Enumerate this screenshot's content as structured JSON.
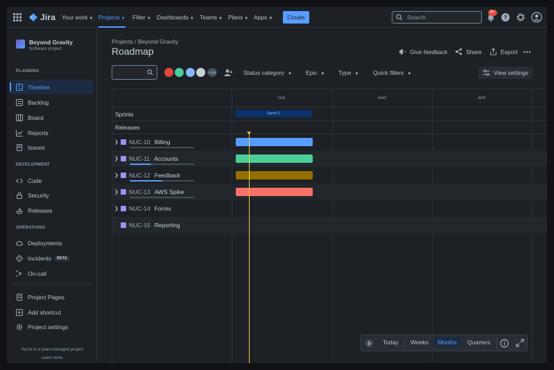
{
  "topnav": {
    "logo": "Jira",
    "items": [
      {
        "label": "Your work"
      },
      {
        "label": "Projects"
      },
      {
        "label": "Filter"
      },
      {
        "label": "Dashboards"
      },
      {
        "label": "Teams"
      },
      {
        "label": "Plans"
      },
      {
        "label": "Apps"
      }
    ],
    "create_label": "Create",
    "search_placeholder": "Search",
    "notification_badge": "9+"
  },
  "sidebar": {
    "project_name": "Beyond Gravity",
    "project_type": "Software project",
    "sections": [
      {
        "heading": "PLANNING",
        "items": [
          "Timeline",
          "Backlog",
          "Board",
          "Reports",
          "Issues"
        ]
      },
      {
        "heading": "DEVELOPMENT",
        "items": [
          "Code",
          "Security",
          "Releases"
        ]
      },
      {
        "heading": "OPERATIONS",
        "items": [
          "Deployments",
          "Incidents",
          "On-call"
        ]
      }
    ],
    "incidents_badge": "BETA",
    "footer_items": [
      "Project Pages",
      "Add shortcut",
      "Project settings"
    ],
    "team_note": "You're in a team-managed project",
    "learn_more": "Learn more"
  },
  "header": {
    "breadcrumb_root": "Projects",
    "breadcrumb_sep": "/",
    "breadcrumb_project": "Beyond Gravity",
    "title": "Roadmap",
    "give_feedback": "Give feedback",
    "share": "Share",
    "export": "Export"
  },
  "toolbar": {
    "avatar_more": "+14",
    "filters": [
      "Status category",
      "Epic",
      "Type",
      "Quick filters"
    ],
    "view_settings": "View settings"
  },
  "timeline": {
    "months": [
      "FEB",
      "MAR",
      "APR"
    ],
    "sprints_label": "Sprints",
    "releases_label": "Releases",
    "sprint_name": "Sprint 2",
    "issues": [
      {
        "key": "NUC-10",
        "title": "Billing",
        "progress": 0,
        "bar_color": "#579dff",
        "expandable": true
      },
      {
        "key": "NUC-11",
        "title": "Accounts",
        "progress": 0.33,
        "bar_color": "#4bce97",
        "expandable": true
      },
      {
        "key": "NUC-12",
        "title": "Feedback",
        "progress": 0.5,
        "bar_color": "#946f00",
        "expandable": true
      },
      {
        "key": "NUC-13",
        "title": "AWS Spike",
        "progress": 0,
        "bar_color": "#f87168",
        "expandable": true
      },
      {
        "key": "NUC-14",
        "title": "Forms",
        "progress": null,
        "bar_color": null,
        "expandable": true
      },
      {
        "key": "NUC-15",
        "title": "Reporting",
        "progress": null,
        "bar_color": null,
        "expandable": false
      }
    ]
  },
  "zoom": {
    "today": "Today",
    "options": [
      "Weeks",
      "Months",
      "Quarters"
    ],
    "selected": "Months"
  }
}
